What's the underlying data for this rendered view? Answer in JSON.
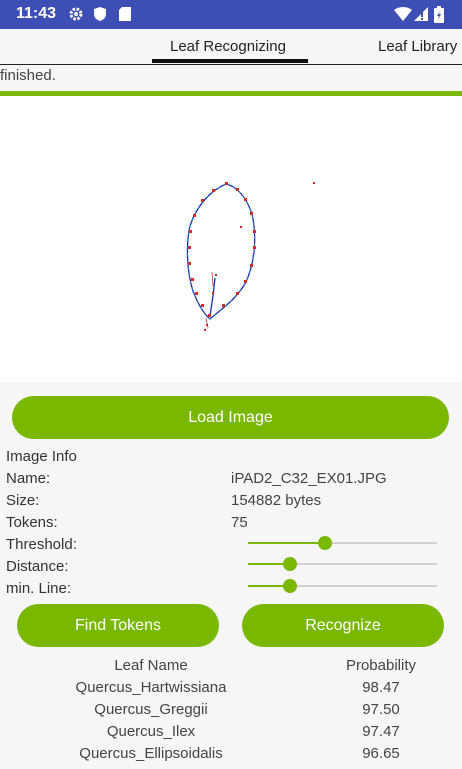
{
  "status_bar": {
    "time": "11:43",
    "icons": [
      "gear-icon",
      "shield-icon",
      "sd-card-icon",
      "wifi-icon",
      "signal-icon",
      "battery-icon"
    ]
  },
  "tabs": [
    {
      "label": "Leaf Recognizing",
      "active": true
    },
    {
      "label": "Leaf Library",
      "active": false
    }
  ],
  "progress": {
    "text": "finished.",
    "value": 1.0
  },
  "buttons": {
    "load": "Load Image",
    "find_tokens": "Find Tokens",
    "recognize": "Recognize"
  },
  "info": {
    "header": "Image Info",
    "name_label": "Name:",
    "name_value": "iPAD2_C32_EX01.JPG",
    "size_label": "Size:",
    "size_value": "154882 bytes",
    "tokens_label": "Tokens:",
    "tokens_value": "75",
    "threshold_label": "Threshold:",
    "threshold_value": 0.4,
    "distance_label": "Distance:",
    "distance_value": 0.2,
    "minline_label": "min. Line:",
    "minline_value": 0.2
  },
  "results": {
    "col_name": "Leaf Name",
    "col_prob": "Probability",
    "rows": [
      {
        "name": "Quercus_Hartwissiana",
        "prob": "98.47"
      },
      {
        "name": "Quercus_Greggii",
        "prob": "97.50"
      },
      {
        "name": "Quercus_Ilex",
        "prob": "97.47"
      },
      {
        "name": "Quercus_Ellipsoidalis",
        "prob": "96.65"
      }
    ]
  },
  "colors": {
    "accent": "#7ab800",
    "status_bar": "#3d4fb5"
  }
}
